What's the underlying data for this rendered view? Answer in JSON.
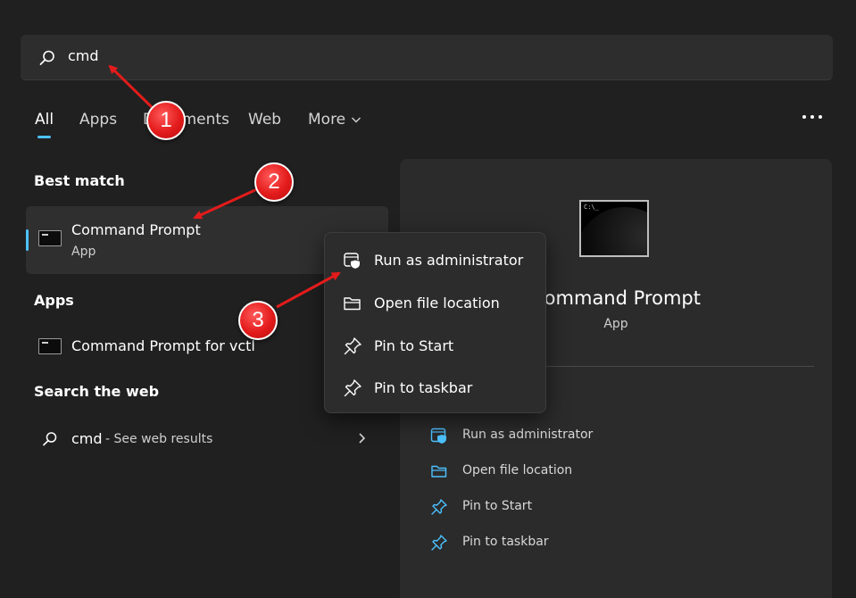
{
  "search": {
    "query": "cmd"
  },
  "tabs": [
    {
      "label": "All"
    },
    {
      "label": "Apps"
    },
    {
      "label": "Documents"
    },
    {
      "label": "Web"
    },
    {
      "label": "More"
    }
  ],
  "left": {
    "best_match_heading": "Best match",
    "best_match": {
      "title": "Command Prompt",
      "subtitle": "App"
    },
    "apps_heading": "Apps",
    "apps_item": "Command Prompt for vctl",
    "web_heading": "Search the web",
    "web_query": "cmd",
    "web_suffix": " - See web results"
  },
  "context_menu": [
    {
      "label": "Run as administrator",
      "icon": "shield-window-icon"
    },
    {
      "label": "Open file location",
      "icon": "folder-icon"
    },
    {
      "label": "Pin to Start",
      "icon": "pin-icon"
    },
    {
      "label": "Pin to taskbar",
      "icon": "pin-icon"
    }
  ],
  "preview": {
    "title": "Command Prompt",
    "subtitle": "App",
    "icon_text": "C:\\_",
    "actions": [
      {
        "label": "Run as administrator",
        "icon": "shield-window-icon"
      },
      {
        "label": "Open file location",
        "icon": "folder-icon"
      },
      {
        "label": "Pin to Start",
        "icon": "pin-icon"
      },
      {
        "label": "Pin to taskbar",
        "icon": "pin-icon"
      }
    ]
  },
  "annotations": {
    "badges": [
      "1",
      "2",
      "3"
    ]
  },
  "colors": {
    "accent": "#4cc2ff",
    "annotation": "#e31b1b",
    "background": "#202020"
  }
}
